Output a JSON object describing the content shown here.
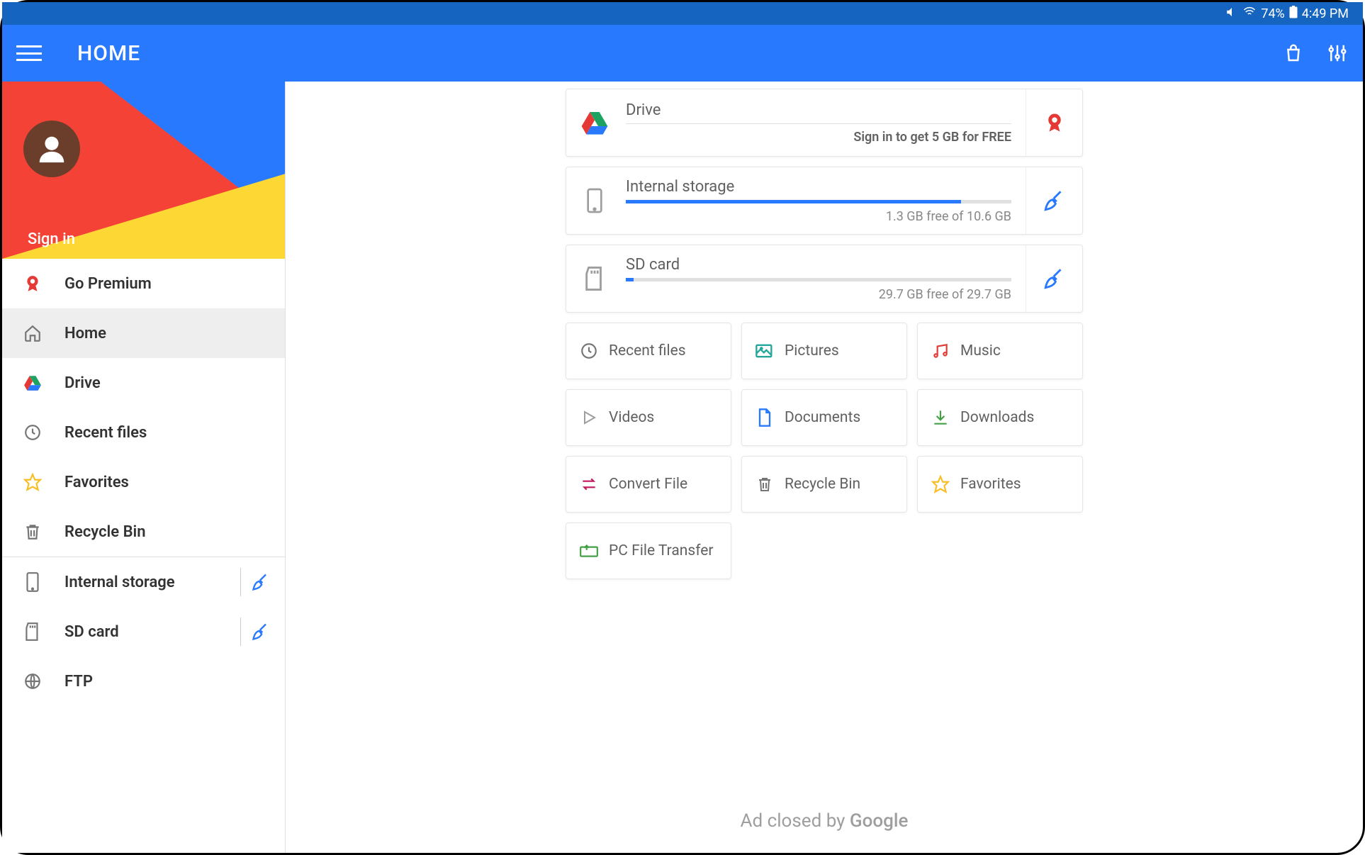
{
  "status": {
    "battery": "74%",
    "time": "4:49 PM"
  },
  "appbar": {
    "title": "HOME"
  },
  "sidebar": {
    "signin": "Sign in",
    "items": [
      {
        "label": "Go Premium"
      },
      {
        "label": "Home"
      },
      {
        "label": "Drive"
      },
      {
        "label": "Recent files"
      },
      {
        "label": "Favorites"
      },
      {
        "label": "Recycle Bin"
      },
      {
        "label": "Internal storage"
      },
      {
        "label": "SD card"
      },
      {
        "label": "FTP"
      }
    ]
  },
  "storage": {
    "drive": {
      "title": "Drive",
      "sub": "Sign in to get 5 GB for FREE"
    },
    "internal": {
      "title": "Internal storage",
      "sub": "1.3 GB free of 10.6 GB",
      "fill": "87%"
    },
    "sd": {
      "title": "SD card",
      "sub": "29.7 GB free of 29.7 GB",
      "fill": "2%"
    }
  },
  "tiles": [
    {
      "label": "Recent files"
    },
    {
      "label": "Pictures"
    },
    {
      "label": "Music"
    },
    {
      "label": "Videos"
    },
    {
      "label": "Documents"
    },
    {
      "label": "Downloads"
    },
    {
      "label": "Convert File"
    },
    {
      "label": "Recycle Bin"
    },
    {
      "label": "Favorites"
    },
    {
      "label": "PC File Transfer"
    }
  ],
  "ad": {
    "prefix": "Ad closed by ",
    "brand": "Google"
  }
}
